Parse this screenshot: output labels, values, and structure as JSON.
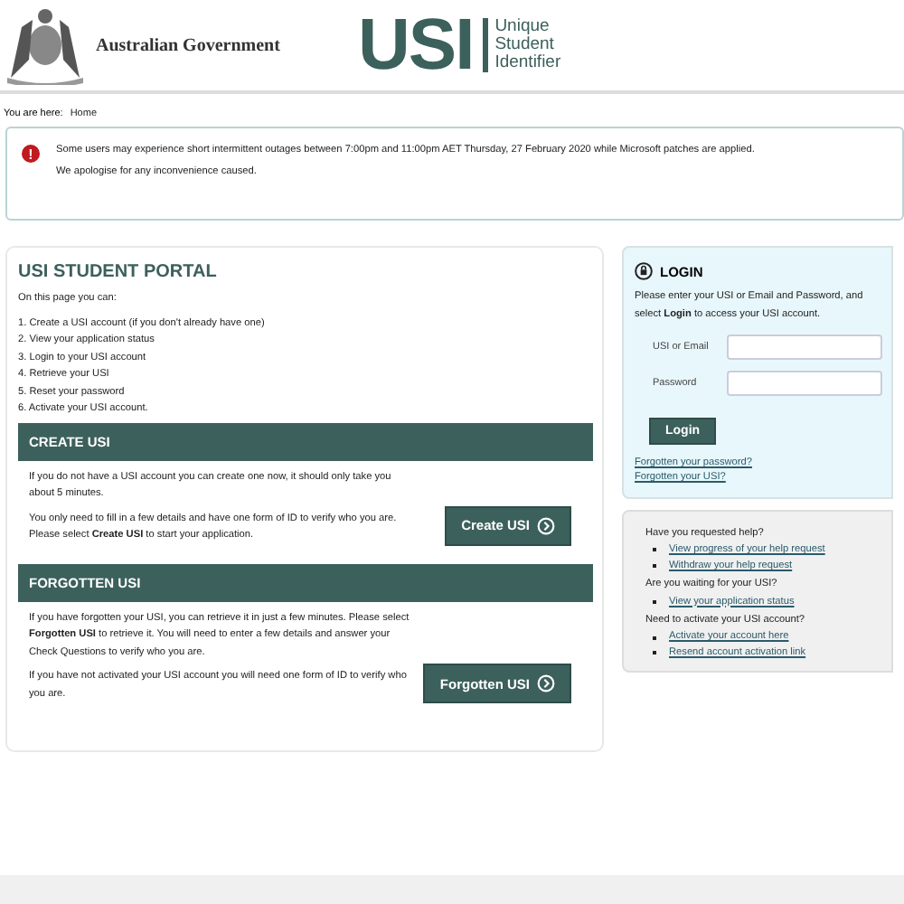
{
  "header": {
    "government": "Australian Government",
    "logo_mark": "USI",
    "logo_text": [
      "Unique",
      "Student",
      "Identifier"
    ]
  },
  "breadcrumb": {
    "label": "You are here:",
    "current": "Home"
  },
  "alert": {
    "icon": "!",
    "lines": [
      "Some users may experience short intermittent outages between 7:00pm and 11:00pm AET Thursday, 27 February 2020 while Microsoft patches are applied.",
      "We apologise for any inconvenience caused."
    ]
  },
  "portal": {
    "title": "USI STUDENT PORTAL",
    "intro": "On this page you can:",
    "items": [
      "1. Create a USI account (if you don't already have one)",
      "2. View your application status",
      "3. Login to your USI account",
      "4. Retrieve your USI",
      "5. Reset your password",
      "6. Activate your USI account."
    ],
    "sections": [
      {
        "heading": "CREATE USI",
        "paragraphs": [
          "If you do not have a USI account you can create one now, it should only take you about 5 minutes.",
          "You only need to fill in a few details and have one form of ID to verify who you are. Please select **Create USI** to start your application."
        ],
        "button": "Create USI"
      },
      {
        "heading": "FORGOTTEN USI",
        "paragraphs": [
          "If you have forgotten your USI, you can retrieve it in just a few minutes. Please select **Forgotten USI** to retrieve it. You will need to enter a few details and answer your Check Questions to verify who you are.",
          "If you have not activated your USI account you will need one form of ID to verify who you are."
        ],
        "button": "Forgotten USI"
      }
    ]
  },
  "login": {
    "title": "LOGIN",
    "intro": "Please enter your USI or Email and Password, and select **Login** to access your USI account.",
    "fields": [
      {
        "label": "USI or Email"
      },
      {
        "label": "Password"
      }
    ],
    "button": "Login",
    "links": [
      "Forgotten your password?",
      "Forgotten your USI?"
    ]
  },
  "help": [
    {
      "question": "Have you requested help?",
      "links": [
        "View progress of your help request",
        "Withdraw your help request"
      ]
    },
    {
      "question": "Are you waiting for your USI?",
      "links": [
        "View your application status"
      ]
    },
    {
      "question": "Need to activate your USI account?",
      "links": [
        "Activate your account here",
        "Resend account activation link"
      ]
    }
  ]
}
